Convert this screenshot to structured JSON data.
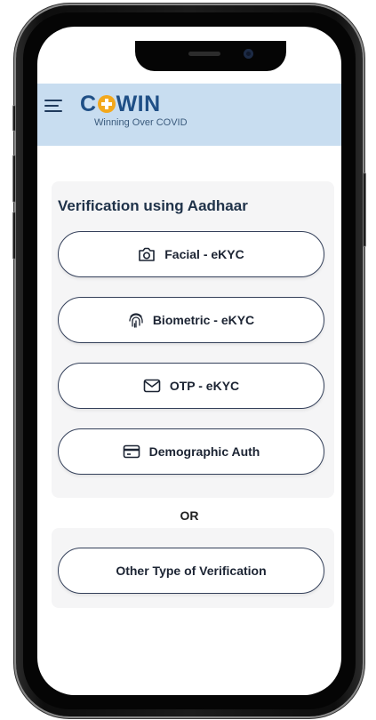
{
  "app": {
    "logo_text_left": "C",
    "logo_text_right": "WIN",
    "tagline": "Winning Over COVID"
  },
  "verification": {
    "title": "Verification using Aadhaar",
    "options": [
      {
        "label": "Facial - eKYC",
        "icon": "camera-icon"
      },
      {
        "label": "Biometric - eKYC",
        "icon": "fingerprint-icon"
      },
      {
        "label": "OTP - eKYC",
        "icon": "envelope-icon"
      },
      {
        "label": "Demographic Auth",
        "icon": "id-card-icon"
      }
    ]
  },
  "separator": "OR",
  "other": {
    "label": "Other Type of Verification"
  },
  "colors": {
    "header_bg": "#c8ddf0",
    "brand_blue": "#1f4f86",
    "brand_orange": "#f3a81c",
    "card_bg": "#f5f5f6"
  }
}
